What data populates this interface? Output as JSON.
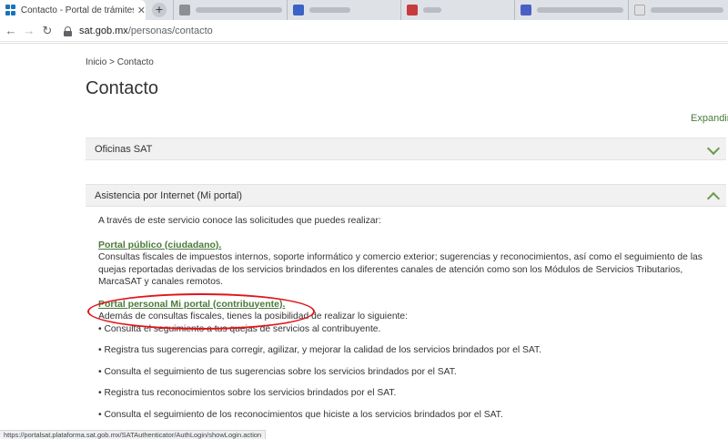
{
  "browser": {
    "active_tab_title": "Contacto - Portal de trámites y se",
    "new_tab_symbol": "+",
    "url_host": "sat.gob.mx",
    "url_path": "/personas/contacto",
    "back_symbol": "←",
    "forward_symbol": "→",
    "reload_symbol": "↻",
    "tab_close_symbol": "✕"
  },
  "breadcrumb": {
    "home": "Inicio",
    "separator": " > ",
    "current": "Contacto"
  },
  "page_title": "Contacto",
  "expand_all": "Expandir",
  "panels": [
    {
      "title": "Oficinas SAT",
      "state": "collapsed"
    },
    {
      "title": "Asistencia por Internet (Mi portal)",
      "state": "expanded"
    }
  ],
  "content": {
    "intro": "A través de este servicio conoce las solicitudes que puedes realizar:",
    "public_link": "Portal público (ciudadano).",
    "public_text": "Consultas fiscales de impuestos internos, soporte informático y comercio exterior; sugerencias y reconocimientos, así como el seguimiento de las quejas reportadas derivadas de los servicios brindados en los diferentes canales de atención como son los Módulos de Servicios Tributarios, MarcaSAT y canales remotos.",
    "personal_link": "Portal personal Mi portal (contribuyente).",
    "personal_text": "Además de consultas fiscales, tienes la posibilidad de realizar lo siguiente:",
    "bullets": [
      "• Consulta el seguimiento a tus quejas de servicios al contribuyente.",
      "• Registra tus sugerencias para corregir, agilizar, y mejorar la calidad de los servicios brindados por el SAT.",
      "• Consulta el seguimiento de tus sugerencias sobre los servicios brindados por el SAT.",
      "• Registra tus reconocimientos sobre los servicios brindados por el SAT.",
      "• Consulta el seguimiento de los reconocimientos que hiciste a los servicios brindados por el SAT."
    ]
  },
  "status_url": "https://portalsat.plataforma.sat.gob.mx/SATAuthenticator/AuthLogin/showLogin.action",
  "colors": {
    "accent_green": "#4a7a3a",
    "annotation_red": "#e0151b",
    "panel_bg": "#f1f1f1"
  }
}
